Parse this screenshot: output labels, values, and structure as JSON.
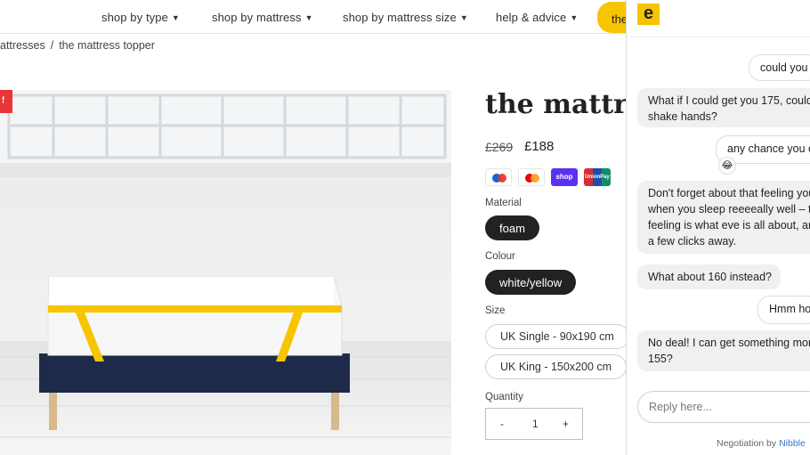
{
  "nav": {
    "items": [
      {
        "label": "shop by type"
      },
      {
        "label": "shop by mattress"
      },
      {
        "label": "shop by mattress size"
      },
      {
        "label": "help & advice"
      }
    ],
    "cta_label": "the",
    "chevron": "chevron-down-icon"
  },
  "breadcrumb": {
    "parent": "attresses",
    "separator": "/",
    "current": "the mattress topper"
  },
  "product": {
    "sale_badge": "f",
    "title": "the mattre",
    "price_old": "£269",
    "price_new": "£188",
    "payment_methods": [
      "maestro",
      "mastercard",
      "shop",
      "unionpay"
    ],
    "shop_pay_label": "shop",
    "unionpay_label": "UnionPay",
    "material_label": "Material",
    "material_value": "foam",
    "colour_label": "Colour",
    "colour_value": "white/yellow",
    "size_label": "Size",
    "sizes": [
      "UK Single - 90x190 cm",
      "UK King - 150x200 cm"
    ],
    "quantity_label": "Quantity",
    "quantity_minus": "-",
    "quantity_value": "1",
    "quantity_plus": "+"
  },
  "chat": {
    "logo_letter": "e",
    "messages": [
      {
        "from": "user",
        "text": "could you d"
      },
      {
        "from": "bot",
        "text": "What if I could get you 175, could\nshake hands?"
      },
      {
        "from": "user",
        "text": "any chance you c"
      },
      {
        "from": "bot",
        "text": "Don't forget about that feeling you\nwhen you sleep reeeeally well – th\nfeeling is what eve is all about, an\na few clicks away."
      },
      {
        "from": "bot",
        "text": "What about 160 instead?"
      },
      {
        "from": "user",
        "text": "Hmm ho"
      },
      {
        "from": "bot",
        "text": "No deal! I can get something more\n155?"
      }
    ],
    "reaction_emoji": "😂",
    "reply_placeholder": "Reply here...",
    "footer_text": "Negotiation by",
    "footer_brand": "Nibble"
  },
  "colors": {
    "accent_yellow": "#f7c600",
    "base_navy": "#1e2a4a",
    "sale_red": "#e8353a",
    "link_blue": "#3b6fd6"
  }
}
